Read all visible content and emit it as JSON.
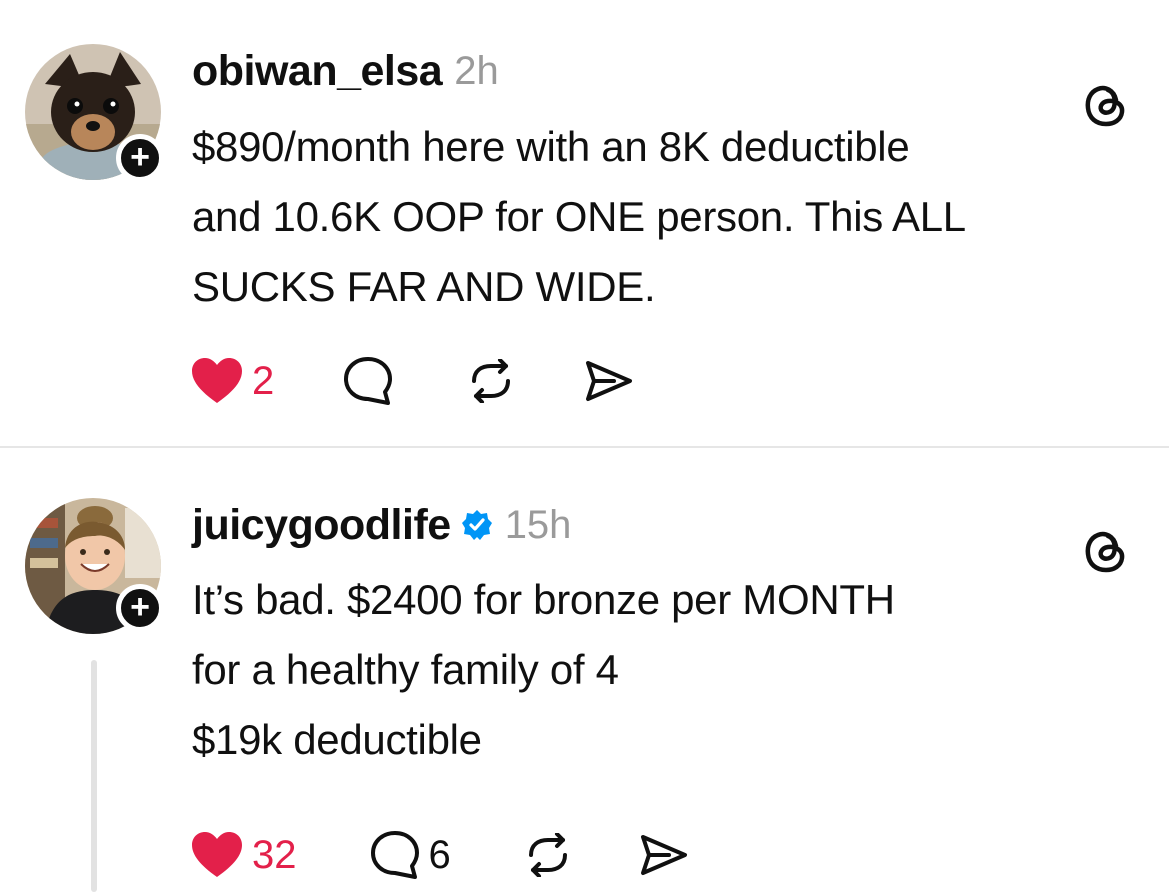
{
  "posts": [
    {
      "username": "obiwan_elsa",
      "time": "2h",
      "verified": false,
      "text": [
        "$890/month here with an 8K deductible",
        "and 10.6K OOP for ONE person. This ALL",
        "SUCKS FAR AND WIDE."
      ],
      "likes": "2",
      "replies": "",
      "avatar": "dog-photo",
      "like_color": "#e3204a"
    },
    {
      "username": "juicygoodlife",
      "time": "15h",
      "verified": true,
      "text": [
        "It’s bad. $2400 for bronze per MONTH",
        "for a healthy family of 4",
        "$19k deductible"
      ],
      "likes": "32",
      "replies": "6",
      "avatar": "woman-photo",
      "like_color": "#e3204a"
    }
  ],
  "icons": {
    "follow": "+",
    "threads": "threads-logo-icon",
    "like": "heart-icon",
    "reply": "comment-icon",
    "repost": "repost-icon",
    "share": "share-icon",
    "verified": "verified-badge-icon"
  },
  "colors": {
    "like": "#e3204a",
    "verified": "#0095f6",
    "muted": "#9a9a9a"
  }
}
